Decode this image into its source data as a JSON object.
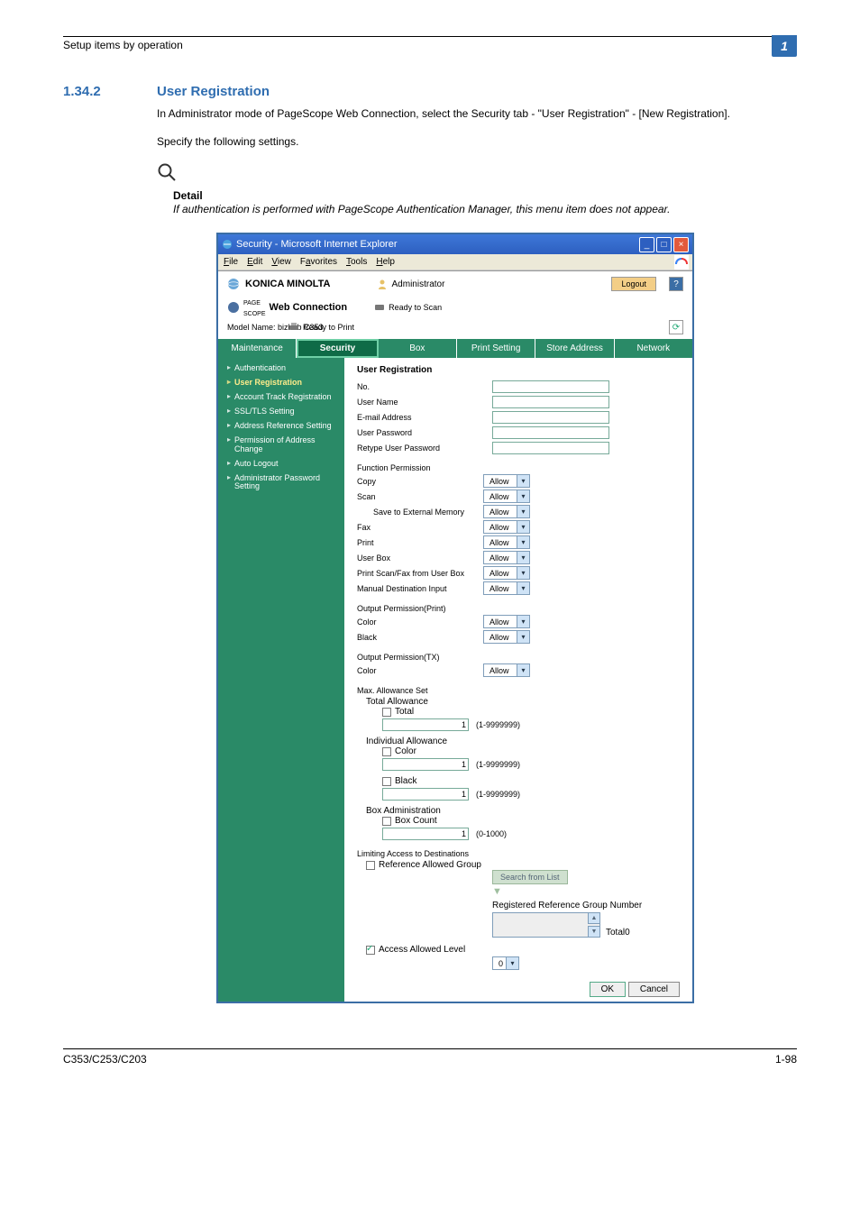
{
  "page": {
    "header_title": "Setup items by operation",
    "chapter_num": "1",
    "section_number": "1.34.2",
    "section_title": "User Registration",
    "intro_paragraph": "In Administrator mode of PageScope Web Connection, select the Security tab - \"User Registration\" - [New Registration].",
    "intro_paragraph2": "Specify the following settings.",
    "detail_label": "Detail",
    "detail_text": "If authentication is performed with PageScope Authentication Manager, this menu item does not appear.",
    "footer_left": "C353/C253/C203",
    "footer_right": "1-98"
  },
  "window": {
    "title": "Security - Microsoft Internet Explorer",
    "menus": [
      "File",
      "Edit",
      "View",
      "Favorites",
      "Tools",
      "Help"
    ]
  },
  "brand": {
    "name": "KONICA MINOLTA",
    "admin_role": "Administrator",
    "logout": "Logout",
    "pagescope_line1": "PAGE",
    "pagescope_line2": "SCOPE",
    "pagescope_name": "Web Connection",
    "model_label": "Model Name: bizhub C353",
    "ready_scan": "Ready to Scan",
    "ready_print": "Ready to Print"
  },
  "tabs": [
    "Maintenance",
    "Security",
    "Box",
    "Print Setting",
    "Store Address",
    "Network"
  ],
  "sidenav": [
    {
      "label": "Authentication",
      "active": false
    },
    {
      "label": "User Registration",
      "active": true
    },
    {
      "label": "Account Track Registration",
      "active": false
    },
    {
      "label": "SSL/TLS Setting",
      "active": false
    },
    {
      "label": "Address Reference Setting",
      "active": false
    },
    {
      "label": "Permission of Address Change",
      "active": false
    },
    {
      "label": "Auto Logout",
      "active": false
    },
    {
      "label": "Administrator Password Setting",
      "active": false
    }
  ],
  "form": {
    "heading": "User Registration",
    "basic_fields": [
      {
        "label": "No."
      },
      {
        "label": "User Name"
      },
      {
        "label": "E-mail Address"
      },
      {
        "label": "User Password"
      },
      {
        "label": "Retype User Password"
      }
    ],
    "func_perm": {
      "title": "Function Permission",
      "rows": [
        {
          "label": "Copy",
          "value": "Allow"
        },
        {
          "label": "Scan",
          "value": "Allow"
        },
        {
          "label": "Save to External Memory",
          "value": "Allow",
          "indent": true
        },
        {
          "label": "Fax",
          "value": "Allow"
        },
        {
          "label": "Print",
          "value": "Allow"
        },
        {
          "label": "User Box",
          "value": "Allow"
        },
        {
          "label": "Print Scan/Fax from User Box",
          "value": "Allow"
        },
        {
          "label": "Manual Destination Input",
          "value": "Allow"
        }
      ]
    },
    "out_print": {
      "title": "Output Permission(Print)",
      "rows": [
        {
          "label": "Color",
          "value": "Allow"
        },
        {
          "label": "Black",
          "value": "Allow"
        }
      ]
    },
    "out_tx": {
      "title": "Output Permission(TX)",
      "rows": [
        {
          "label": "Color",
          "value": "Allow"
        }
      ]
    },
    "max_allow": {
      "title": "Max. Allowance Set",
      "total_title": "Total Allowance",
      "total_chk": "Total",
      "total_val": "1",
      "total_range": "(1-9999999)",
      "indiv_title": "Individual Allowance",
      "color_chk": "Color",
      "color_val": "1",
      "color_range": "(1-9999999)",
      "black_chk": "Black",
      "black_val": "1",
      "black_range": "(1-9999999)",
      "box_title": "Box Administration",
      "box_chk": "Box Count",
      "box_val": "1",
      "box_range": "(0-1000)"
    },
    "limit_dest": {
      "title": "Limiting Access to Destinations",
      "ref_group_chk": "Reference Allowed Group",
      "search_btn": "Search from List",
      "reg_group_label": "Registered Reference Group Number",
      "total_label": "Total0",
      "access_level_chk": "Access Allowed Level",
      "access_level_val": "0"
    },
    "ok": "OK",
    "cancel": "Cancel"
  }
}
